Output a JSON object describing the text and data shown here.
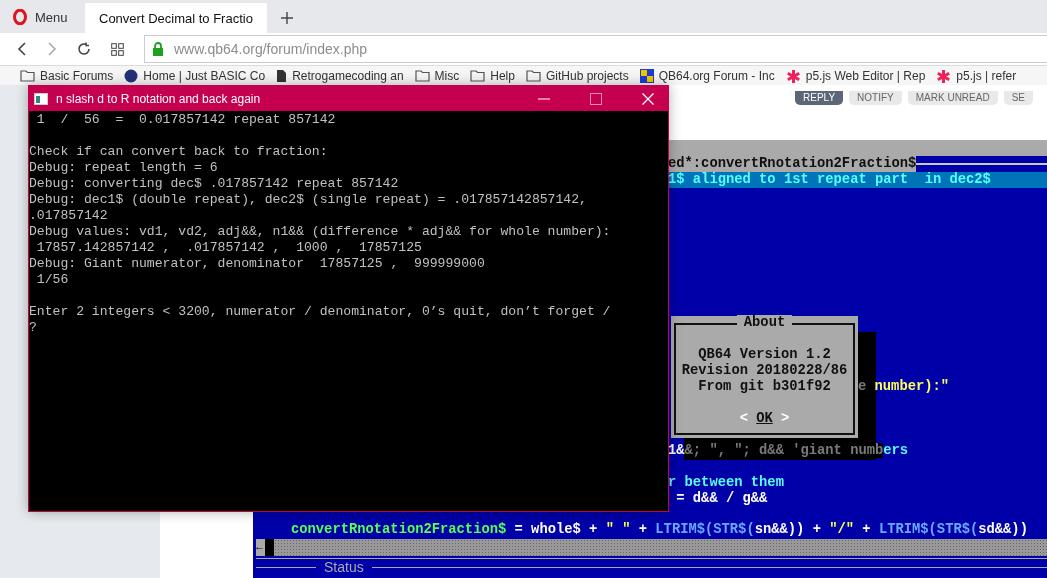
{
  "browser": {
    "menu_label": "Menu",
    "tabs": [
      {
        "title": "Convert Decimal to Fractio",
        "selected": true
      }
    ],
    "url": "www.qb64.org/forum/index.php",
    "bookmarks": [
      {
        "label": "Basic Forums",
        "kind": "folder"
      },
      {
        "label": "Home | Just BASIC Co",
        "kind": "site"
      },
      {
        "label": "Retrogamecoding an",
        "kind": "page"
      },
      {
        "label": "Misc",
        "kind": "folder"
      },
      {
        "label": "Help",
        "kind": "folder"
      },
      {
        "label": "GitHub projects",
        "kind": "folder"
      },
      {
        "label": "QB64.org Forum - Inc",
        "kind": "qb64"
      },
      {
        "label": "p5.js Web Editor | Rep",
        "kind": "star"
      },
      {
        "label": "p5.js | refer",
        "kind": "star"
      }
    ],
    "forum_buttons": [
      {
        "label": "REPLY",
        "kind": "primary"
      },
      {
        "label": "NOTIFY",
        "kind": "plain"
      },
      {
        "label": "MARK UNREAD",
        "kind": "plain"
      },
      {
        "label": "SE",
        "kind": "plain"
      }
    ]
  },
  "ide": {
    "title": "ed*:convertRnotation2Fraction$",
    "current_line": "1$ aligned to 1st repeat part  in dec2$",
    "code_lines": [
      [
        {
          "text": "e",
          "kind": "shadow"
        },
        {
          "text": " number):\"",
          "kind": "string"
        }
      ],
      [
        {
          "text": "1&",
          "kind": "plain"
        },
        {
          "text": "&; \", \"; d&& 'giant numb",
          "kind": "shadow"
        },
        {
          "text": "ers",
          "kind": "comment"
        }
      ],
      [
        {
          "text": "r between them",
          "kind": "comment"
        }
      ],
      [
        {
          "text": " = d&& / g&&",
          "kind": "plain"
        }
      ],
      [
        {
          "text": "convertRnotation2Fraction$",
          "kind": "name"
        },
        {
          "text": " = whole$ + ",
          "kind": "plain"
        },
        {
          "text": "\" \"",
          "kind": "string"
        },
        {
          "text": " + ",
          "kind": "plain"
        },
        {
          "text": "LTRIM$(STR$(",
          "kind": "keyword"
        },
        {
          "text": "sn&&)) + ",
          "kind": "plain"
        },
        {
          "text": "\"/\"",
          "kind": "string"
        },
        {
          "text": " + ",
          "kind": "plain"
        },
        {
          "text": "LTRIM$(STR$(",
          "kind": "keyword"
        },
        {
          "text": "sd&&))",
          "kind": "plain"
        }
      ]
    ],
    "scroll_arrow": "←",
    "status_label": "Status"
  },
  "about": {
    "title": "About",
    "lines": [
      "QB64 Version 1.2",
      "Revision 20180228/86",
      "From git b301f92"
    ],
    "button": {
      "left": "<",
      "label": "OK",
      "right": ">"
    }
  },
  "console": {
    "title": "n slash d to R notation and back again",
    "lines": [
      {
        "text": " 1  /  56  =  0.017857142 repeat 857142",
        "blank_before": false
      },
      {
        "text": "Check if can convert back to fraction:",
        "blank_before": true
      },
      {
        "text": "Debug: repeat length = 6",
        "blank_before": false
      },
      {
        "text": "Debug: converting dec$ .017857142 repeat 857142",
        "blank_before": false
      },
      {
        "text": "Debug: dec1$ (double repeat), dec2$ (single repeat) = .017857142857142,",
        "blank_before": false
      },
      {
        "text": ".017857142",
        "blank_before": false
      },
      {
        "text": "Debug values: vd1, vd2, adj&&, n1&& (difference * adj&& for whole number):",
        "blank_before": false
      },
      {
        "text": " 17857.142857142 ,  .017857142 ,  1000 ,  17857125",
        "blank_before": false
      },
      {
        "text": "Debug: Giant numerator, denominator  17857125 ,  999999000",
        "blank_before": false
      },
      {
        "text": " 1/56",
        "blank_before": false
      },
      {
        "text": "Enter 2 integers < 3200, numerator / denominator, 0’s quit, don’t forget /",
        "blank_before": true
      },
      {
        "text": "?",
        "blank_before": false
      }
    ]
  }
}
